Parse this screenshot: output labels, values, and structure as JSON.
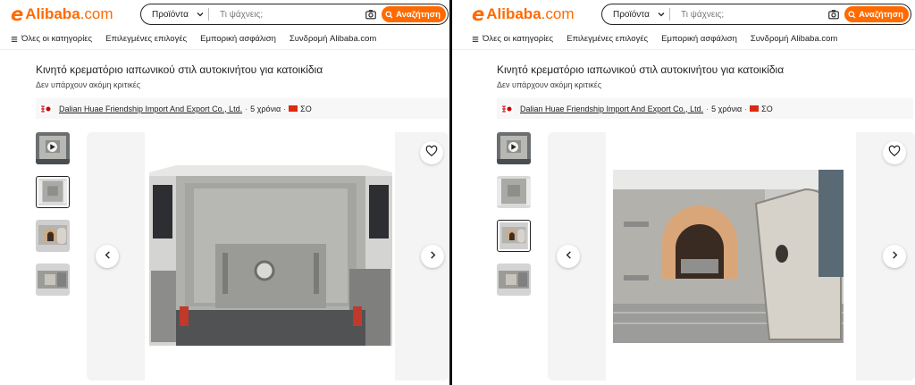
{
  "brand": {
    "mark": "e",
    "name": "Alibaba",
    "suffix": ".com",
    "color": "#ff6a00"
  },
  "search": {
    "category": "Προϊόντα",
    "placeholder": "Τι ψάχνεις;",
    "button_label": "Αναζήτηση"
  },
  "nav": {
    "items": [
      "Όλες οι κατηγορίες",
      "Επιλεγμένες επιλογές",
      "Εμπορική ασφάλιση",
      "Συνδρομή Alibaba.com"
    ]
  },
  "product": {
    "title": "Κινητό κρεματόριο ιαπωνικού στιλ αυτοκινήτου για κατοικίδια",
    "reviews": "Δεν υπάρχουν ακόμη κριτικές"
  },
  "supplier": {
    "name": "Dalian Huae Friendship Import And Export Co., Ltd.",
    "years": "5 χρόνια",
    "country": "ΣΟ"
  },
  "gallery": {
    "left_active_thumb": 1,
    "right_active_thumb": 2,
    "thumb_count": 4
  },
  "icons": {
    "prev": "chevron-left-icon",
    "next": "chevron-right-icon",
    "favorite": "heart-icon",
    "camera": "camera-icon",
    "search": "search-icon",
    "menu": "menu-icon",
    "dropdown": "chevron-down-icon"
  }
}
